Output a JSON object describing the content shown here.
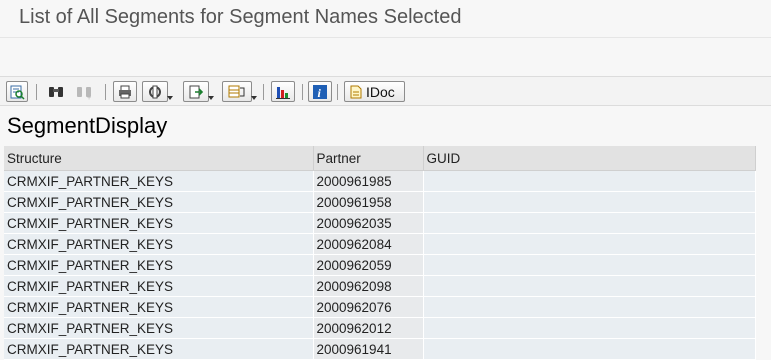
{
  "window": {
    "title": "List of All Segments for Segment Names Selected"
  },
  "toolbar": {
    "buttons": [
      {
        "icon": "details-icon",
        "enabled": true
      },
      {
        "icon": "binoculars-find-icon",
        "enabled": true
      },
      {
        "icon": "find-next-icon",
        "enabled": false
      },
      {
        "icon": "print-icon",
        "enabled": true
      },
      {
        "icon": "layout-icon",
        "enabled": true
      },
      {
        "icon": "export-icon",
        "enabled": true
      },
      {
        "icon": "filter-icon",
        "enabled": true
      },
      {
        "icon": "chart-icon",
        "enabled": true
      },
      {
        "icon": "info-icon",
        "enabled": true
      },
      {
        "icon": "idoc-icon",
        "enabled": true
      }
    ],
    "idoc_label": "IDoc"
  },
  "section": {
    "title": "SegmentDisplay"
  },
  "table": {
    "columns": [
      "Structure",
      "Partner",
      "GUID"
    ],
    "rows": [
      {
        "structure": "CRMXIF_PARTNER_KEYS",
        "partner": "2000961985",
        "guid": ""
      },
      {
        "structure": "CRMXIF_PARTNER_KEYS",
        "partner": "2000961958",
        "guid": ""
      },
      {
        "structure": "CRMXIF_PARTNER_KEYS",
        "partner": "2000962035",
        "guid": ""
      },
      {
        "structure": "CRMXIF_PARTNER_KEYS",
        "partner": "2000962084",
        "guid": ""
      },
      {
        "structure": "CRMXIF_PARTNER_KEYS",
        "partner": "2000962059",
        "guid": ""
      },
      {
        "structure": "CRMXIF_PARTNER_KEYS",
        "partner": "2000962098",
        "guid": ""
      },
      {
        "structure": "CRMXIF_PARTNER_KEYS",
        "partner": "2000962076",
        "guid": ""
      },
      {
        "structure": "CRMXIF_PARTNER_KEYS",
        "partner": "2000962012",
        "guid": ""
      },
      {
        "structure": "CRMXIF_PARTNER_KEYS",
        "partner": "2000961941",
        "guid": ""
      }
    ]
  }
}
